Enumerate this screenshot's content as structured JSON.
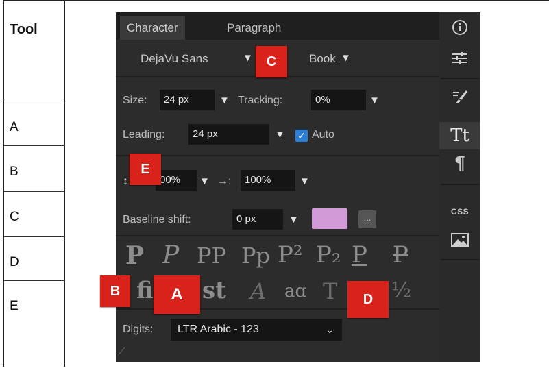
{
  "table": {
    "header": "Tool",
    "rows": [
      "A",
      "B",
      "C",
      "D",
      "E"
    ]
  },
  "panel": {
    "tabs": [
      "Character",
      "Paragraph"
    ],
    "font_family": "DejaVu Sans",
    "font_style": "Book",
    "size_label": "Size:",
    "size_value": "24 px",
    "tracking_label": "Tracking:",
    "tracking_value": "0%",
    "leading_label": "Leading:",
    "leading_value": "24 px",
    "auto_label": "Auto",
    "auto_checked": true,
    "vscale_value": "00%",
    "hscale_label": "→:",
    "hscale_value": "100%",
    "baseline_label": "Baseline shift:",
    "baseline_value": "0 px",
    "swatch_color": "#d39ad8",
    "more_label": "...",
    "style_glyphs_row1": [
      "P",
      "P",
      "PP",
      "Pp",
      "P²",
      "P₂",
      "P",
      "P"
    ],
    "style_glyphs_row2": [
      "fi",
      "st",
      "A",
      "aɑ",
      "T",
      "½"
    ],
    "digits_label": "Digits:",
    "digits_value": "LTR Arabic - 123"
  },
  "sidebar": {
    "icons": [
      "info-icon",
      "sliders-icon",
      "brush-icon",
      "text-icon",
      "paragraph-icon",
      "css-icon",
      "image-icon"
    ],
    "css_label": "CSS",
    "text_label": "Tt",
    "paragraph_label": "¶"
  },
  "markers": [
    "A",
    "B",
    "C",
    "D",
    "E"
  ]
}
